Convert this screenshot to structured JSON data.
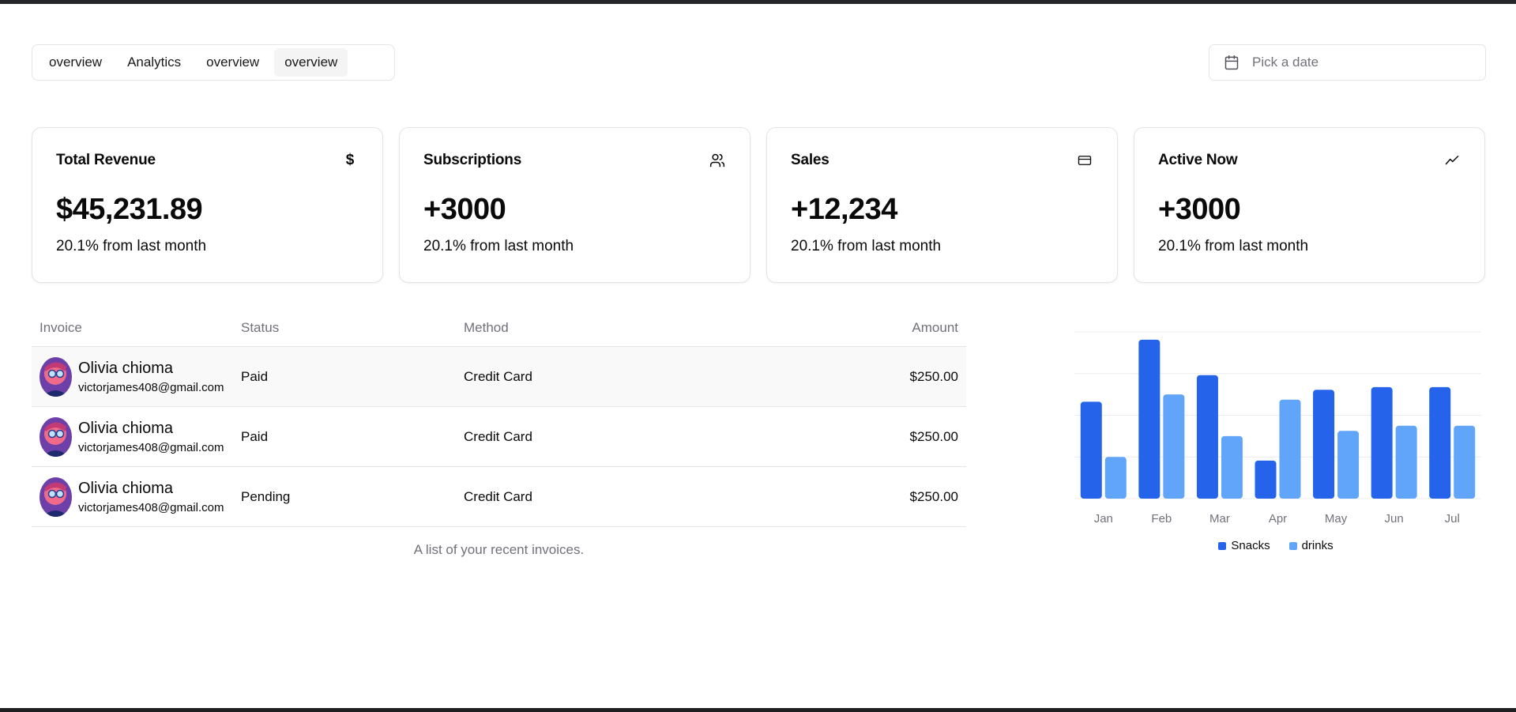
{
  "tabs": [
    {
      "label": "overview"
    },
    {
      "label": "Analytics"
    },
    {
      "label": "overview"
    },
    {
      "label": "overview"
    }
  ],
  "active_tab_index": 3,
  "date_picker": {
    "placeholder": "Pick a date",
    "icon": "calendar-icon"
  },
  "cards": [
    {
      "title": "Total Revenue",
      "icon": "dollar-icon",
      "icon_glyph": "$",
      "value": "$45,231.89",
      "sub": "20.1% from last month"
    },
    {
      "title": "Subscriptions",
      "icon": "users-icon",
      "value": "+3000",
      "sub": "20.1% from last month"
    },
    {
      "title": "Sales",
      "icon": "credit-card-icon",
      "value": "+12,234",
      "sub": "20.1% from last month"
    },
    {
      "title": "Active Now",
      "icon": "activity-icon",
      "value": "+3000",
      "sub": "20.1% from last month"
    }
  ],
  "table": {
    "headers": {
      "invoice": "Invoice",
      "status": "Status",
      "method": "Method",
      "amount": "Amount"
    },
    "rows": [
      {
        "name": "Olivia chioma",
        "email": "victorjames408@gmail.com",
        "status": "Paid",
        "method": "Credit Card",
        "amount": "$250.00"
      },
      {
        "name": "Olivia chioma",
        "email": "victorjames408@gmail.com",
        "status": "Paid",
        "method": "Credit Card",
        "amount": "$250.00"
      },
      {
        "name": "Olivia chioma",
        "email": "victorjames408@gmail.com",
        "status": "Pending",
        "method": "Credit Card",
        "amount": "$250.00"
      }
    ],
    "caption": "A list of your recent invoices."
  },
  "colors": {
    "snacks": "#2563eb",
    "drinks": "#60a5fa"
  },
  "chart_data": {
    "type": "bar",
    "categories": [
      "Jan",
      "Feb",
      "Mar",
      "Apr",
      "May",
      "Jun",
      "Jul"
    ],
    "series": [
      {
        "name": "Snacks",
        "values": [
          186,
          305,
          237,
          73,
          209,
          214,
          214
        ]
      },
      {
        "name": "drinks",
        "values": [
          80,
          200,
          120,
          190,
          130,
          140,
          140
        ]
      }
    ],
    "ylim": [
      0,
      320
    ],
    "grid": true,
    "legend": "bottom-center"
  }
}
